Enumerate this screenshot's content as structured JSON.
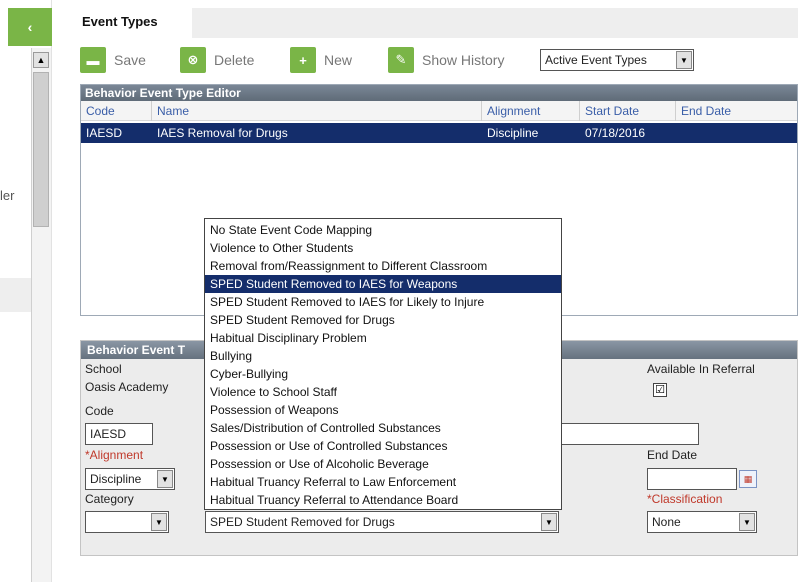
{
  "nav": {
    "back_icon": "chevron-left-icon",
    "back_glyph": "‹",
    "left_text": "ler"
  },
  "tab": {
    "title": "Event Types"
  },
  "toolbar": {
    "save_label": "Save",
    "delete_label": "Delete",
    "new_label": "New",
    "history_label": "Show History",
    "filter_value": "Active Event Types",
    "save_glyph": "▬",
    "delete_glyph": "⊗",
    "new_glyph": "+",
    "history_glyph": "✎"
  },
  "editor": {
    "title": "Behavior Event Type Editor",
    "columns": [
      "Code",
      "Name",
      "Alignment",
      "Start Date",
      "End Date"
    ],
    "rows": [
      {
        "code": "IAESD",
        "name": "IAES Removal for Drugs",
        "alignment": "Discipline",
        "start_date": "07/18/2016",
        "end_date": ""
      }
    ]
  },
  "detail": {
    "title": "Behavior Event T",
    "school_label": "School",
    "school_value": "Oasis Academy",
    "code_label": "Code",
    "code_value": "IAESD",
    "alignment_label": "*Alignment",
    "alignment_value": "Discipline",
    "category_label": "Category",
    "category_value": "",
    "state_code_value": "SPED Student Removed for Drugs",
    "available_label": "Available In Referral",
    "available_checked": "☑",
    "end_date_label": "End Date",
    "end_date_value": "",
    "classification_label": "*Classification",
    "classification_value": "None"
  },
  "state_code_dropdown": {
    "options": [
      "No State Event Code Mapping",
      "Violence to Other Students",
      "Removal from/Reassignment to Different Classroom",
      "SPED Student Removed to IAES for Weapons",
      "SPED Student Removed to IAES for Likely to Injure",
      "SPED Student Removed for Drugs",
      "Habitual Disciplinary Problem",
      "Bullying",
      "Cyber-Bullying",
      "Violence to School Staff",
      "Possession of Weapons",
      "Sales/Distribution of Controlled Substances",
      "Possession or Use of Controlled Substances",
      "Possession or Use of Alcoholic Beverage",
      "Habitual Truancy Referral to Law Enforcement",
      "Habitual Truancy Referral to Attendance Board"
    ],
    "highlighted": "SPED Student Removed to IAES for Weapons"
  },
  "colors": {
    "brand_green": "#7ab547",
    "selection_navy": "#142d6b",
    "link_blue": "#3a5ea8",
    "required_red": "#c0392b"
  }
}
